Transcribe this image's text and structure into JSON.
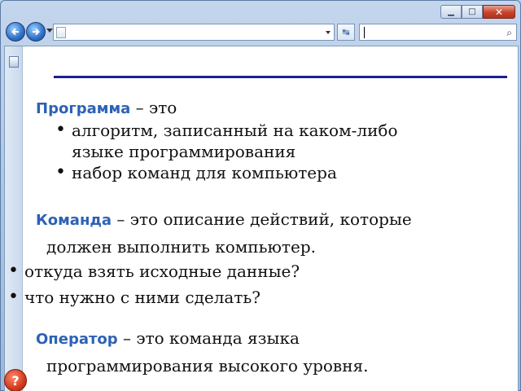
{
  "window": {
    "minimize_icon": "minimize-icon",
    "maximize_icon": "maximize-icon",
    "close_glyph": "✕"
  },
  "navbar": {
    "address_value": "",
    "search_value": ""
  },
  "slide": {
    "program": {
      "term": "Программа",
      "rest": " – это",
      "items": [
        {
          "line1": "алгоритм, записанный на каком-либо",
          "line2": "языке программирования"
        },
        {
          "line1": "набор команд для компьютера",
          "line2": ""
        }
      ]
    },
    "command": {
      "term": "Команда",
      "rest": " – это описание действий, которые",
      "line2": "должен выполнить компьютер.",
      "items": [
        "откуда взять исходные данные?",
        "что нужно с ними сделать?"
      ]
    },
    "operator": {
      "term": "Оператор",
      "rest": " – это команда языка",
      "line2": "программирования высокого уровня."
    }
  },
  "colors": {
    "term": "#2d62b5",
    "rule": "#1c1f8c",
    "help": "#d23a1c"
  }
}
